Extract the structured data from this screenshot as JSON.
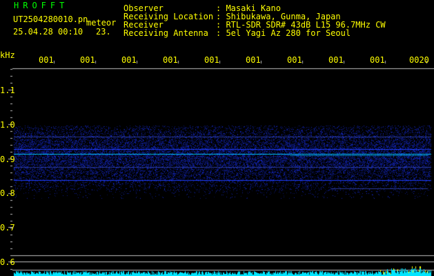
{
  "header": {
    "app_title": "HROFFT",
    "filename": "UT2504280010.pn",
    "meteor_label": "meteor",
    "datetime": "25.04.28 00:10",
    "count": "23.",
    "info": [
      {
        "label": "Observer",
        "value": ": Masaki Kano"
      },
      {
        "label": "Receiving Location",
        "value": ": Shibukawa, Gunma, Japan"
      },
      {
        "label": "Receiver",
        "value": ": RTL-SDR SDR# 43dB L15 96.7MHz CW"
      },
      {
        "label": "Receiving Antenna",
        "value": ": 5el Yagi Az 280 for Seoul"
      }
    ]
  },
  "axis": {
    "unit": "kHz",
    "y_ticks": [
      "1.1",
      "1.0",
      "0.9",
      "0.8",
      "0.7",
      "0.6"
    ],
    "time_ticks": [
      "001",
      "001",
      "001",
      "001",
      "001",
      "001",
      "001",
      "001",
      "001",
      "0020"
    ]
  },
  "colors": {
    "title": "#00ff00",
    "text": "#ffff00",
    "axis": "#c0c0c0",
    "signal": "#1e3cff",
    "bright_line": "#00c8ff",
    "activity": "#00e5ff"
  }
}
